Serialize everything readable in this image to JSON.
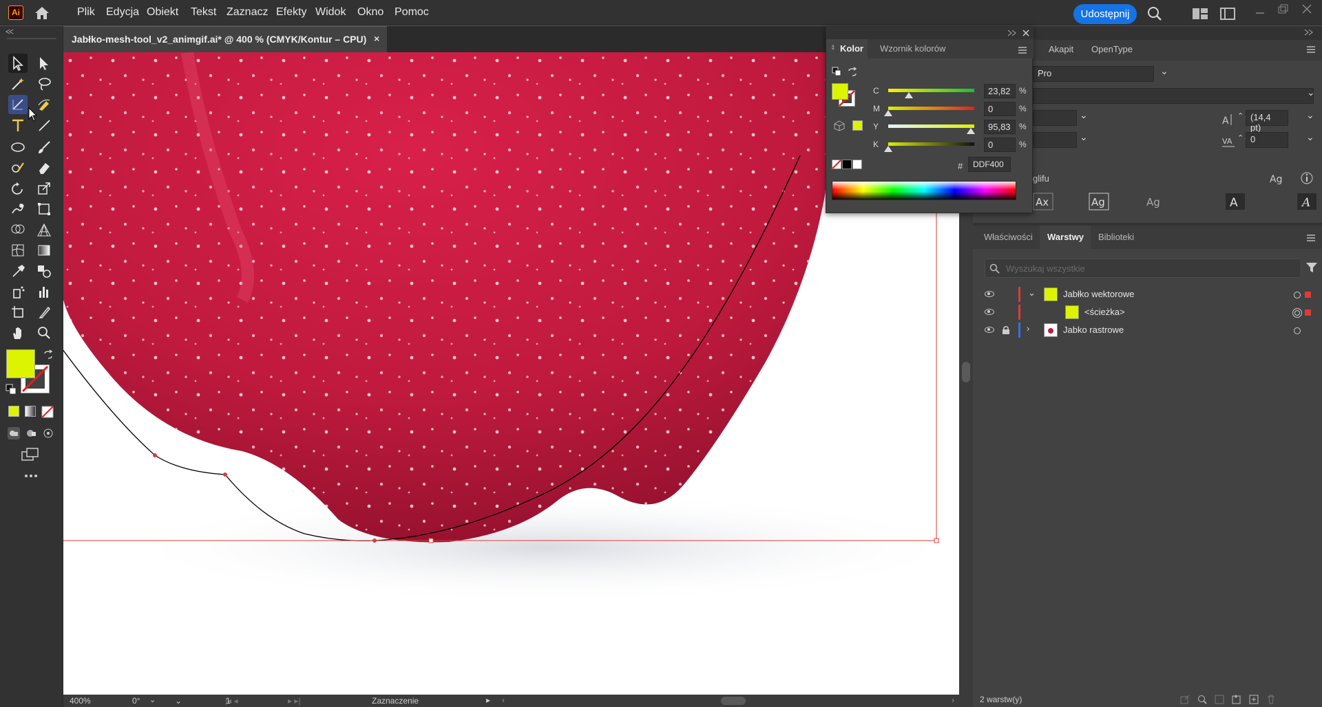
{
  "app": {
    "logo_text": "Ai",
    "share_label": "Udostępnij"
  },
  "menu": [
    "Plik",
    "Edycja",
    "Obiekt",
    "Tekst",
    "Zaznacz",
    "Efekty",
    "Widok",
    "Okno",
    "Pomoc"
  ],
  "document_tab": {
    "title": "Jabłko-mesh-tool_v2_animgif.ai* @ 400 % (CMYK/Kontur – CPU)",
    "close": "×"
  },
  "color_panel": {
    "tabs": [
      "Kolor",
      "Wzornik kolorów"
    ],
    "fill_color": "#DDF400",
    "sliders": [
      {
        "label": "C",
        "value": "23,82",
        "unit": "%",
        "level": 0.2382
      },
      {
        "label": "M",
        "value": "0",
        "unit": "%",
        "level": 0
      },
      {
        "label": "Y",
        "value": "95,83",
        "unit": "%",
        "level": 0.9583
      },
      {
        "label": "K",
        "value": "0",
        "unit": "%",
        "level": 0
      }
    ],
    "hex_symbol": "#",
    "hex_value": "DDF400"
  },
  "char_panel": {
    "tabs": [
      "Akapit",
      "OpenType"
    ],
    "font_family": "Pro",
    "leading": "(14,4 pt)",
    "tracking": "0",
    "glyph_label": "glifu"
  },
  "layers_panel": {
    "tabs": [
      "Właściwości",
      "Warstwy",
      "Biblioteki"
    ],
    "search_placeholder": "Wyszukaj wszystkie",
    "layers": [
      {
        "name": "Jabłko wektorowe",
        "color": "#e03a3a"
      },
      {
        "name": "<ścieżka>",
        "color": "#e03a3a"
      },
      {
        "name": "Jabko rastrowe",
        "color": "#3a6fe0"
      }
    ],
    "footer": "2 warstw(y)"
  },
  "status_bar": {
    "zoom": "400%",
    "rotation": "0°",
    "artboard": "1",
    "tool_name": "Zaznaczenie"
  },
  "colors": {
    "fill": "#DDF400",
    "selection": "#e03a3a",
    "share": "#1473e6"
  }
}
